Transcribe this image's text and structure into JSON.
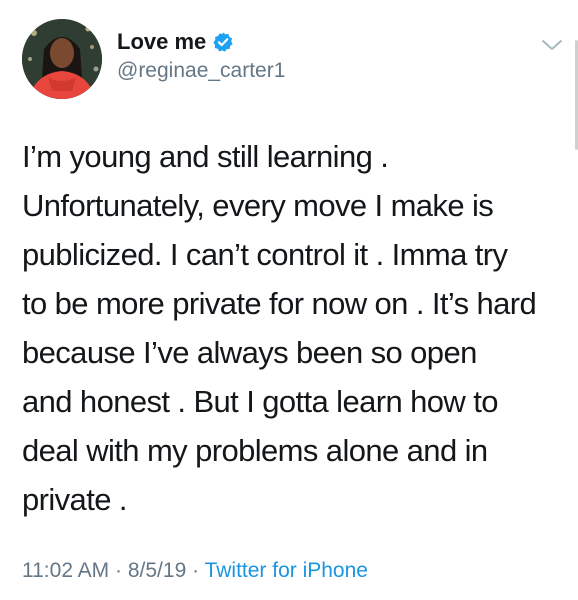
{
  "tweet": {
    "display_name": "Love me",
    "handle": "@reginae_carter1",
    "text_lines": [
      "I’m young and still learning .",
      "Unfortunately, every move I make is",
      "publicized. I can’t control it . Imma try",
      "to be more private for now on . It’s hard",
      "because I’ve always been so open",
      "and honest . But I gotta learn how to",
      "deal with my problems alone and in",
      "private ."
    ],
    "time": "11:02 AM",
    "date": "8/5/19",
    "separator": "·",
    "source": "Twitter for iPhone"
  },
  "icons": {
    "verified": "verified-badge-icon",
    "caret": "chevron-down-icon"
  },
  "colors": {
    "verified_blue": "#1da1f2",
    "link_blue": "#1b95e0",
    "secondary_gray": "#657786",
    "text_dark": "#14171a"
  }
}
